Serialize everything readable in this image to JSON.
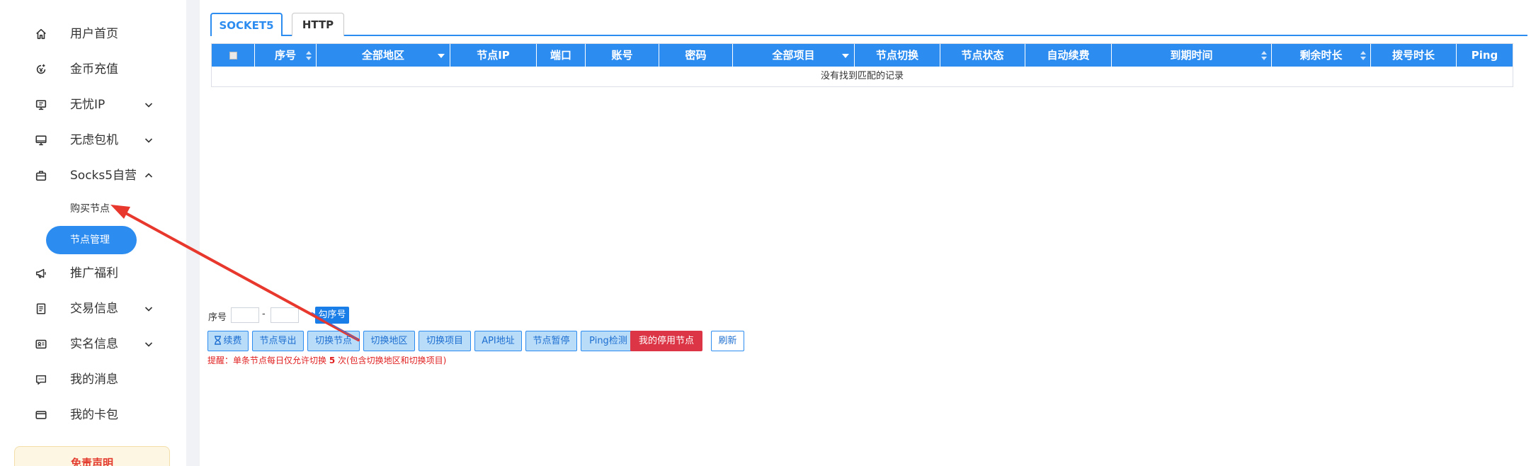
{
  "sidebar": {
    "items": [
      {
        "label": "用户首页",
        "icon": "home-icon"
      },
      {
        "label": "金币充值",
        "icon": "coin-recharge-icon"
      },
      {
        "label": "无忧IP",
        "icon": "ip-monitor-icon"
      },
      {
        "label": "无虑包机",
        "icon": "desktop-icon"
      },
      {
        "label": "Socks5自营",
        "icon": "briefcase-icon"
      },
      {
        "label": "推广福利",
        "icon": "megaphone-icon"
      },
      {
        "label": "交易信息",
        "icon": "document-icon"
      },
      {
        "label": "实名信息",
        "icon": "id-card-icon"
      },
      {
        "label": "我的消息",
        "icon": "message-icon"
      },
      {
        "label": "我的卡包",
        "icon": "card-icon"
      }
    ],
    "sub_items": [
      {
        "label": "购买节点"
      },
      {
        "label": "节点管理"
      }
    ],
    "disclaimer": "免责声明"
  },
  "tabs": [
    {
      "label": "SOCKET5",
      "active": true
    },
    {
      "label": "HTTP",
      "active": false
    }
  ],
  "table": {
    "columns": [
      "序号",
      "全部地区",
      "节点IP",
      "端口",
      "账号",
      "密码",
      "全部项目",
      "节点切换",
      "节点状态",
      "自动续费",
      "到期时间",
      "剩余时长",
      "拨号时长",
      "Ping"
    ],
    "empty_text": "没有找到匹配的记录"
  },
  "controls": {
    "seq_label": "序号",
    "seq_dash": "-",
    "seq_button": "勾序号",
    "buttons": [
      "续费",
      "节点导出",
      "切换节点",
      "切换地区",
      "切换项目",
      "API地址",
      "节点暂停",
      "Ping检测",
      "我的停用节点",
      "刷新"
    ],
    "notice_prefix": "提醒：单条节点每日仅允许切换 ",
    "notice_count": "5",
    "notice_suffix": " 次(包含切换地区和切换项目)"
  },
  "colors": {
    "primary": "#2d8cf0",
    "danger": "#dc3545",
    "notice": "#e02020",
    "annotation_arrow": "#e8372c"
  }
}
